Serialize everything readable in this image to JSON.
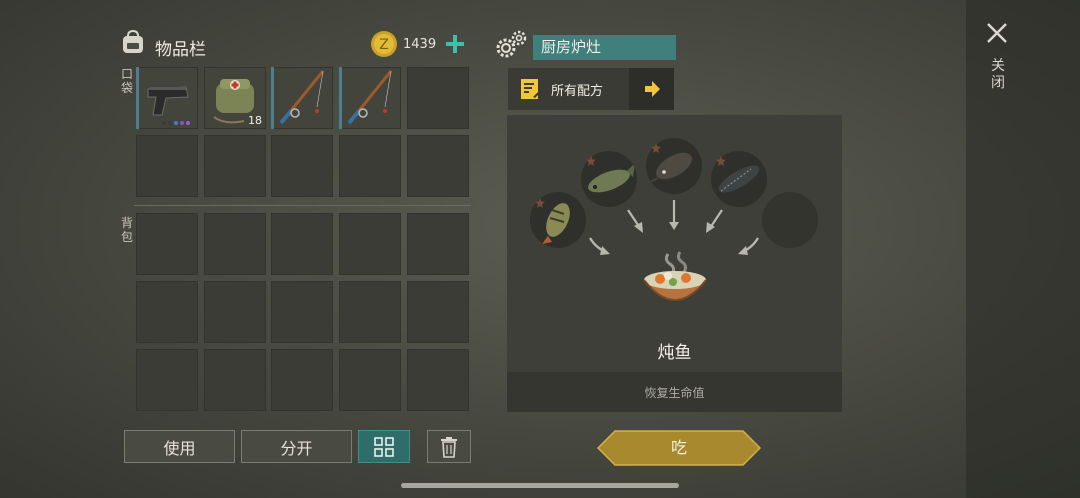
{
  "inventory": {
    "title": "物品栏",
    "coins": "1439",
    "pocket_label": "口袋",
    "backpack_label": "背包",
    "pocket_slots": [
      {
        "item": "pistol",
        "quality_dots": [
          "#3b3b3b",
          "#3b3b3b",
          "#5b73c7",
          "#7a5bc7",
          "#9a5bd0"
        ]
      },
      {
        "item": "first-aid-bag",
        "count": "18"
      },
      {
        "item": "fishing-rod"
      },
      {
        "item": "fishing-rod"
      },
      {
        "item": "empty"
      }
    ]
  },
  "actions": {
    "use": "使用",
    "split": "分开"
  },
  "crafting": {
    "station": "厨房炉灶",
    "all_recipes": "所有配方",
    "result_name": "炖鱼",
    "result_desc": "恢复生命值",
    "eat": "吃",
    "ingredients": [
      "perch",
      "pike",
      "catfish",
      "sturgeon",
      "empty"
    ]
  },
  "window": {
    "close_label": "关闭"
  },
  "colors": {
    "accent_teal": "#3f7f7c",
    "gold": "#b8962e",
    "arrow_yellow": "#f0c63a"
  }
}
